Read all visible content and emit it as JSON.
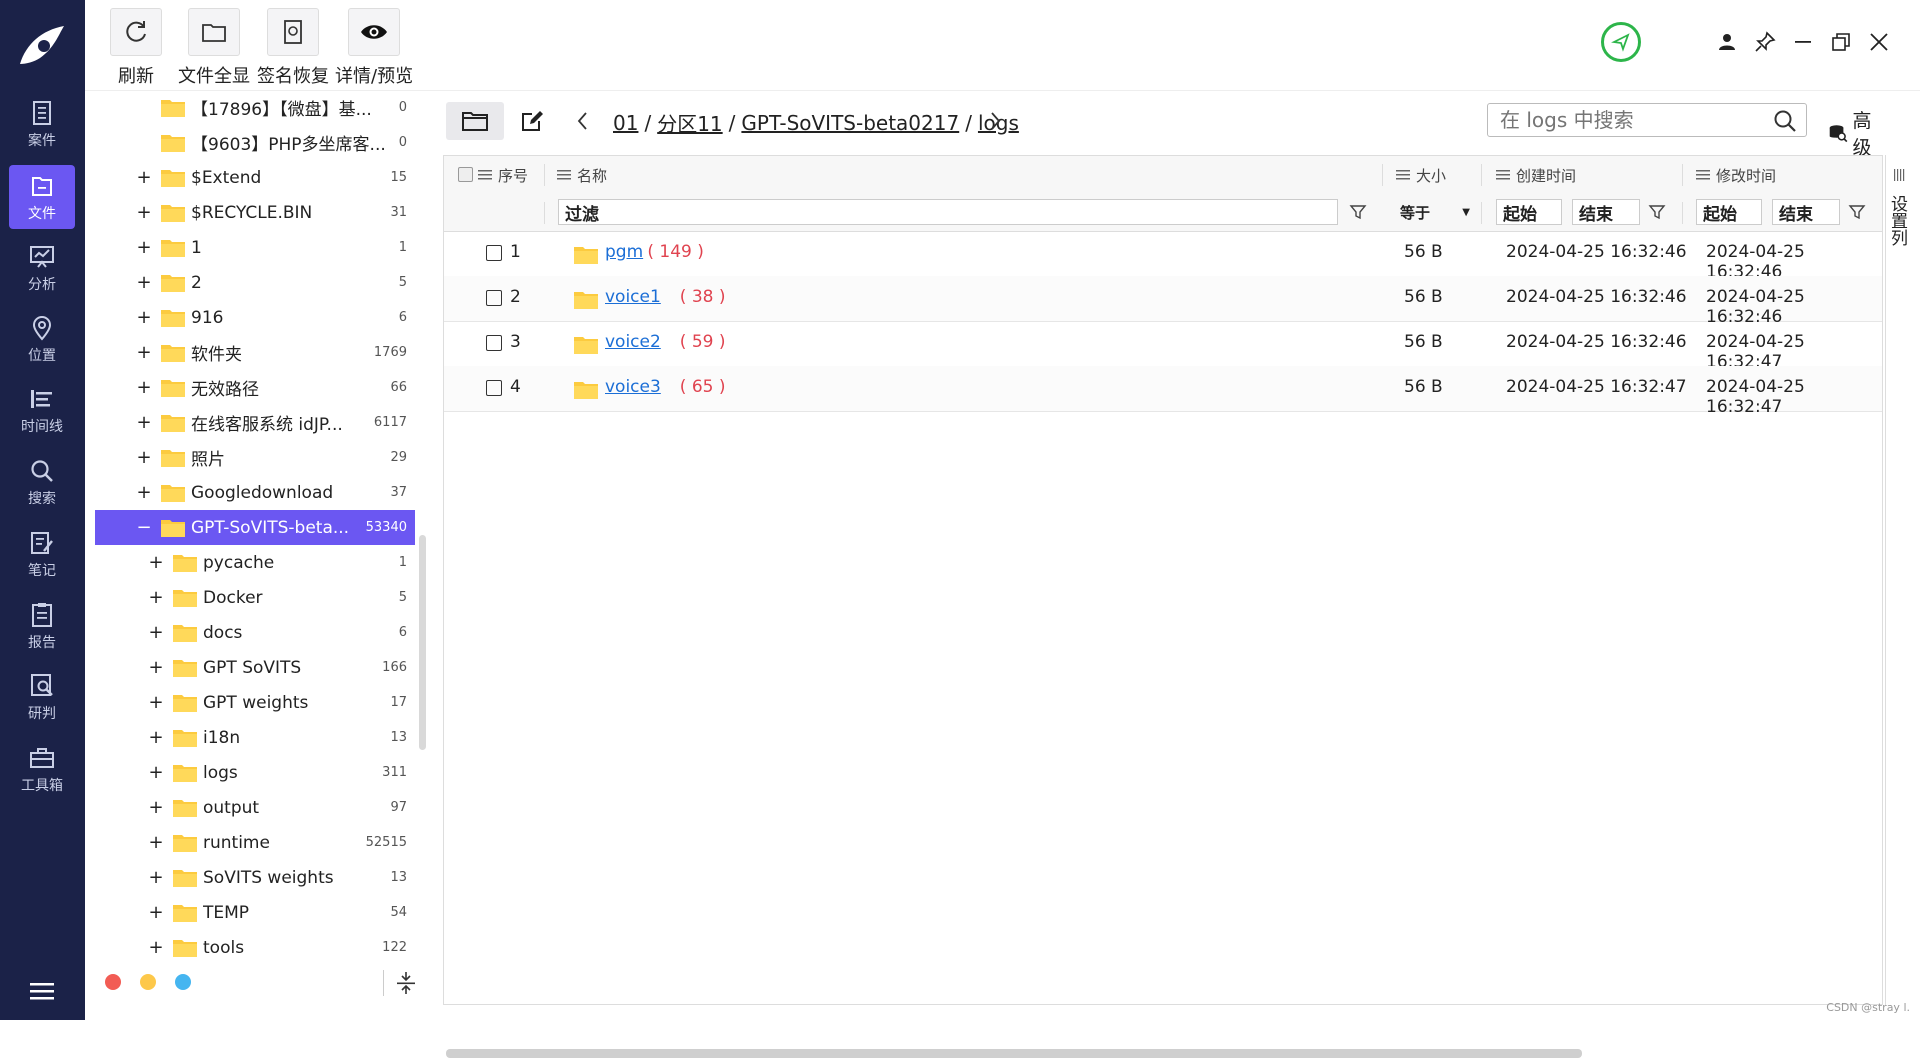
{
  "nav": {
    "items": [
      {
        "label": "案件",
        "icon": "case-icon"
      },
      {
        "label": "文件",
        "icon": "file-icon",
        "active": true
      },
      {
        "label": "分析",
        "icon": "analysis-icon"
      },
      {
        "label": "位置",
        "icon": "location-icon"
      },
      {
        "label": "时间线",
        "icon": "timeline-icon"
      },
      {
        "label": "搜索",
        "icon": "search-icon"
      },
      {
        "label": "笔记",
        "icon": "note-icon"
      },
      {
        "label": "报告",
        "icon": "report-icon"
      },
      {
        "label": "研判",
        "icon": "judge-icon"
      },
      {
        "label": "工具箱",
        "icon": "toolbox-icon"
      }
    ]
  },
  "toolbar": {
    "refresh": "刷新",
    "file_full": "文件全显",
    "sig_restore": "签名恢复",
    "detail": "详情/预览"
  },
  "tree": {
    "rows": [
      {
        "pm": "",
        "name": "【17896】【微盘】基...",
        "count": "0"
      },
      {
        "pm": "",
        "name": "【9603】PHP多坐席客...",
        "count": "0"
      },
      {
        "pm": "+",
        "name": "$Extend",
        "count": "15"
      },
      {
        "pm": "+",
        "name": "$RECYCLE.BIN",
        "count": "31"
      },
      {
        "pm": "+",
        "name": "1",
        "count": "1"
      },
      {
        "pm": "+",
        "name": "2",
        "count": "5"
      },
      {
        "pm": "+",
        "name": "916",
        "count": "6"
      },
      {
        "pm": "+",
        "name": "软件夹",
        "count": "1769"
      },
      {
        "pm": "+",
        "name": "无效路径",
        "count": "66"
      },
      {
        "pm": "+",
        "name": "在线客服系统 idJP...",
        "count": "6117"
      },
      {
        "pm": "+",
        "name": "照片",
        "count": "29"
      },
      {
        "pm": "+",
        "name": "Googledownload",
        "count": "37"
      },
      {
        "pm": "−",
        "name": "GPT-SoVITS-beta...",
        "count": "53340",
        "selected": true
      },
      {
        "pm": "+",
        "name": "  pycache",
        "count": "1",
        "child": true
      },
      {
        "pm": "+",
        "name": "Docker",
        "count": "5",
        "child": true
      },
      {
        "pm": "+",
        "name": "docs",
        "count": "6",
        "child": true
      },
      {
        "pm": "+",
        "name": "GPT SoVITS",
        "count": "166",
        "child": true
      },
      {
        "pm": "+",
        "name": "GPT weights",
        "count": "17",
        "child": true
      },
      {
        "pm": "+",
        "name": "i18n",
        "count": "13",
        "child": true
      },
      {
        "pm": "+",
        "name": "logs",
        "count": "311",
        "child": true
      },
      {
        "pm": "+",
        "name": "output",
        "count": "97",
        "child": true
      },
      {
        "pm": "+",
        "name": "runtime",
        "count": "52515",
        "child": true
      },
      {
        "pm": "+",
        "name": "SoVITS weights",
        "count": "13",
        "child": true
      },
      {
        "pm": "+",
        "name": "TEMP",
        "count": "54",
        "child": true
      },
      {
        "pm": "+",
        "name": "tools",
        "count": "122",
        "child": true
      }
    ],
    "dot_colors": [
      "#f25c54",
      "#fdc84a",
      "#45b5f0"
    ]
  },
  "path": {
    "crumbs": [
      "01",
      "分区11",
      "GPT-SoVITS-beta0217",
      "logs"
    ],
    "search_placeholder": "在 logs 中搜索",
    "advanced": "高级"
  },
  "grid": {
    "headers": {
      "index": "序号",
      "name": "名称",
      "size": "大小",
      "created": "创建时间",
      "modified": "修改时间"
    },
    "filter": {
      "name_placeholder": "过滤",
      "size_op": "等于",
      "created_start": "起始",
      "created_end": "结束",
      "modified_start": "起始",
      "modified_end": "结束"
    },
    "rows": [
      {
        "idx": "1",
        "name": "pgm",
        "count": "( 149 )",
        "size": "56 B",
        "created": "2024-04-25 16:32:46",
        "modified": "2024-04-25 16:32:46"
      },
      {
        "idx": "2",
        "name": "voice1",
        "count": "( 38 )",
        "size": "56 B",
        "created": "2024-04-25 16:32:46",
        "modified": "2024-04-25 16:32:46"
      },
      {
        "idx": "3",
        "name": "voice2",
        "count": "( 59 )",
        "size": "56 B",
        "created": "2024-04-25 16:32:46",
        "modified": "2024-04-25 16:32:47"
      },
      {
        "idx": "4",
        "name": "voice3",
        "count": "( 65 )",
        "size": "56 B",
        "created": "2024-04-25 16:32:47",
        "modified": "2024-04-25 16:32:47"
      }
    ],
    "settings_col": "设置列"
  },
  "watermark": "CSDN @stray l."
}
